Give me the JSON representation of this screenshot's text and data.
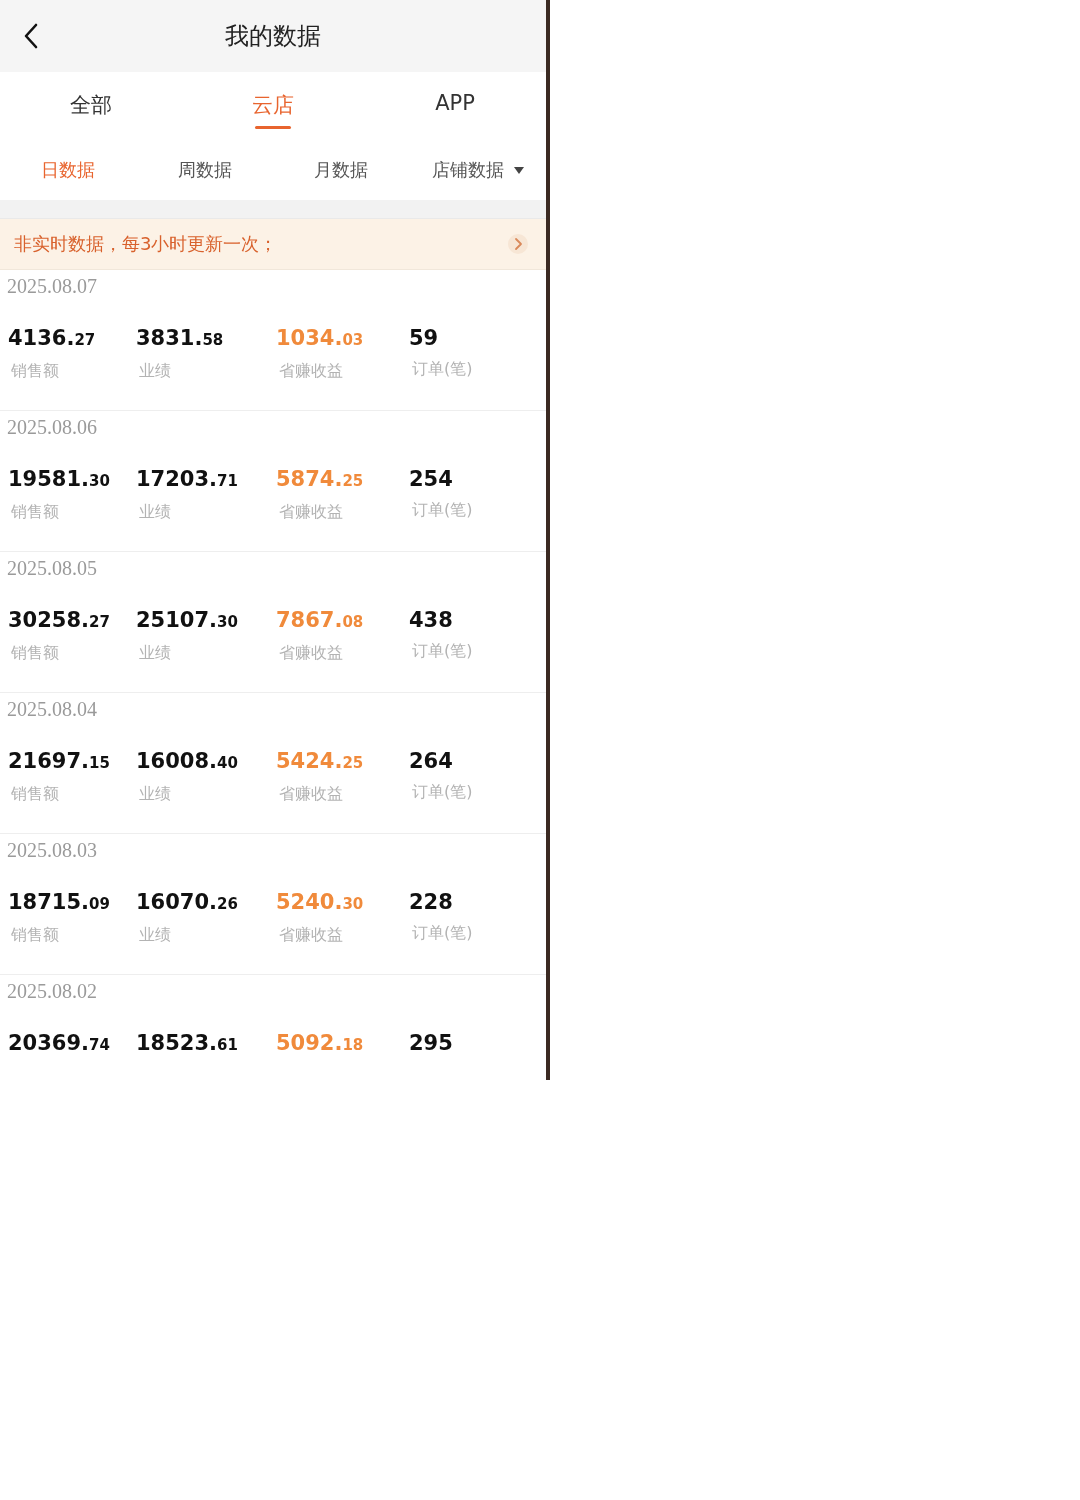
{
  "header": {
    "title": "我的数据"
  },
  "tabs": [
    {
      "label": "全部",
      "selected": false
    },
    {
      "label": "云店",
      "selected": true
    },
    {
      "label": "APP",
      "selected": false
    }
  ],
  "sub_tabs": [
    {
      "label": "日数据",
      "selected": true,
      "kind": "plain"
    },
    {
      "label": "周数据",
      "selected": false,
      "kind": "plain"
    },
    {
      "label": "月数据",
      "selected": false,
      "kind": "plain"
    },
    {
      "label": "店铺数据",
      "selected": false,
      "kind": "dropdown"
    }
  ],
  "notice": {
    "text": "非实时数据，每3小时更新一次；"
  },
  "records": [
    {
      "date": "2025.08.07",
      "metrics": [
        {
          "kind": "amount",
          "whole": "4136.",
          "fraction": "27",
          "label": "销售额"
        },
        {
          "kind": "amount",
          "whole": "3831.",
          "fraction": "58",
          "label": "业绩"
        },
        {
          "kind": "earnings",
          "whole": "1034.",
          "fraction": "03",
          "label": "省赚收益"
        },
        {
          "kind": "count",
          "whole": "59",
          "label": "订单(笔)"
        }
      ]
    },
    {
      "date": "2025.08.06",
      "metrics": [
        {
          "kind": "amount",
          "whole": "19581.",
          "fraction": "30",
          "label": "销售额"
        },
        {
          "kind": "amount",
          "whole": "17203.",
          "fraction": "71",
          "label": "业绩"
        },
        {
          "kind": "earnings",
          "whole": "5874.",
          "fraction": "25",
          "label": "省赚收益"
        },
        {
          "kind": "count",
          "whole": "254",
          "label": "订单(笔)"
        }
      ]
    },
    {
      "date": "2025.08.05",
      "metrics": [
        {
          "kind": "amount",
          "whole": "30258.",
          "fraction": "27",
          "label": "销售额"
        },
        {
          "kind": "amount",
          "whole": "25107.",
          "fraction": "30",
          "label": "业绩"
        },
        {
          "kind": "earnings",
          "whole": "7867.",
          "fraction": "08",
          "label": "省赚收益"
        },
        {
          "kind": "count",
          "whole": "438",
          "label": "订单(笔)"
        }
      ]
    },
    {
      "date": "2025.08.04",
      "metrics": [
        {
          "kind": "amount",
          "whole": "21697.",
          "fraction": "15",
          "label": "销售额"
        },
        {
          "kind": "amount",
          "whole": "16008.",
          "fraction": "40",
          "label": "业绩"
        },
        {
          "kind": "earnings",
          "whole": "5424.",
          "fraction": "25",
          "label": "省赚收益"
        },
        {
          "kind": "count",
          "whole": "264",
          "label": "订单(笔)"
        }
      ]
    },
    {
      "date": "2025.08.03",
      "metrics": [
        {
          "kind": "amount",
          "whole": "18715.",
          "fraction": "09",
          "label": "销售额"
        },
        {
          "kind": "amount",
          "whole": "16070.",
          "fraction": "26",
          "label": "业绩"
        },
        {
          "kind": "earnings",
          "whole": "5240.",
          "fraction": "30",
          "label": "省赚收益"
        },
        {
          "kind": "count",
          "whole": "228",
          "label": "订单(笔)"
        }
      ]
    },
    {
      "date": "2025.08.02",
      "metrics": [
        {
          "kind": "amount",
          "whole": "20369.",
          "fraction": "74"
        },
        {
          "kind": "amount",
          "whole": "18523.",
          "fraction": "61"
        },
        {
          "kind": "earnings",
          "whole": "5092.",
          "fraction": "18"
        },
        {
          "kind": "count",
          "whole": "295"
        }
      ]
    }
  ]
}
